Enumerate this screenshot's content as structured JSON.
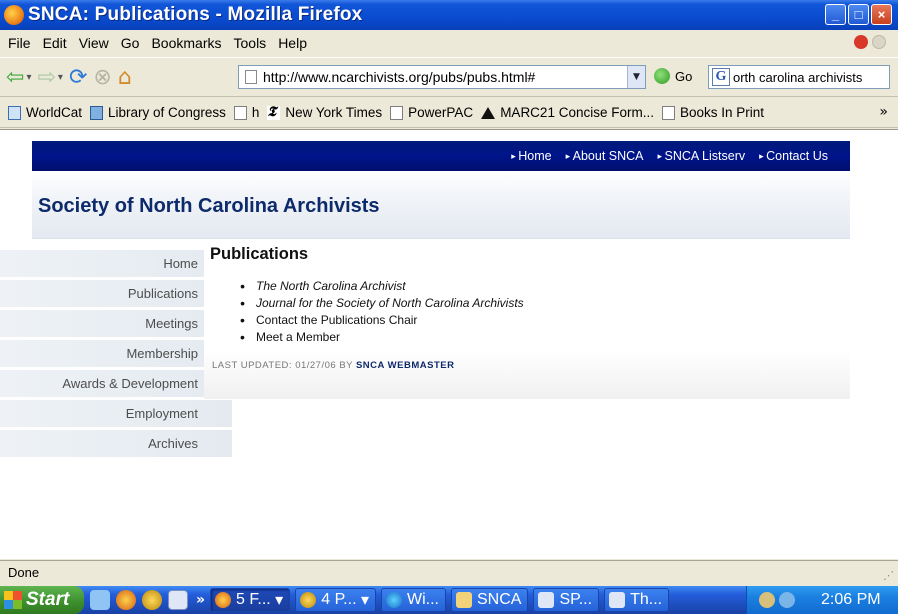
{
  "window": {
    "title": "SNCA: Publications - Mozilla Firefox",
    "buttons": {
      "minimize": "_",
      "maximize": "□",
      "close": "×"
    }
  },
  "menubar": [
    "File",
    "Edit",
    "View",
    "Go",
    "Bookmarks",
    "Tools",
    "Help"
  ],
  "navigation": {
    "url": "http://www.ncarchivists.org/pubs/pubs.html#",
    "go_label": "Go",
    "search_query": "orth carolina archivists",
    "search_engine_icon": "G"
  },
  "bookmarks": [
    {
      "label": "WorldCat",
      "icon": "worldcat-icon"
    },
    {
      "label": "Library of Congress",
      "icon": "loc-icon"
    },
    {
      "label": "h",
      "icon": "page-icon"
    },
    {
      "label": "New York Times",
      "icon": "nyt-icon"
    },
    {
      "label": "PowerPAC",
      "icon": "page-icon"
    },
    {
      "label": "MARC21 Concise Form...",
      "icon": "triangle-icon"
    },
    {
      "label": "Books In Print",
      "icon": "page-icon"
    }
  ],
  "bookmarks_more": "»",
  "site": {
    "top_links": [
      "Home",
      "About SNCA",
      "SNCA Listserv",
      "Contact Us"
    ],
    "title": "Society of North Carolina Archivists",
    "sidebar": [
      "Home",
      "Publications",
      "Meetings",
      "Membership",
      "Awards & Development",
      "Employment",
      "Archives"
    ],
    "page_heading": "Publications",
    "publications": [
      {
        "label": "The North Carolina Archivist",
        "italic": true
      },
      {
        "label": "Journal for the Society of North Carolina Archivists",
        "italic": true
      },
      {
        "label": "Contact the Publications Chair",
        "italic": false
      },
      {
        "label": "Meet a Member",
        "italic": false
      }
    ],
    "updated_prefix": "LAST UPDATED: 01/27/06 BY",
    "updated_by": "SNCA WEBMASTER"
  },
  "status": "Done",
  "taskbar": {
    "start_label": "Start",
    "quick_more": "»",
    "tasks": [
      {
        "label": "5 F...",
        "icon": "firefox-icon",
        "active": true,
        "dropdown": true
      },
      {
        "label": "4 P...",
        "icon": "opera-icon",
        "active": false,
        "dropdown": true
      },
      {
        "label": "Wi...",
        "icon": "chrome-icon",
        "active": false,
        "dropdown": false
      },
      {
        "label": "SNCA",
        "icon": "folder-icon",
        "active": false,
        "dropdown": false
      },
      {
        "label": "SP...",
        "icon": "app-icon",
        "active": false,
        "dropdown": false
      },
      {
        "label": "Th...",
        "icon": "doc-icon",
        "active": false,
        "dropdown": false
      }
    ],
    "clock": "2:06 PM"
  },
  "colors": {
    "site_nav_bg": "#00148a",
    "site_title": "#0d2a6b",
    "xp_blue": "#0a4bd0",
    "start_green": "#3c8d2c"
  }
}
